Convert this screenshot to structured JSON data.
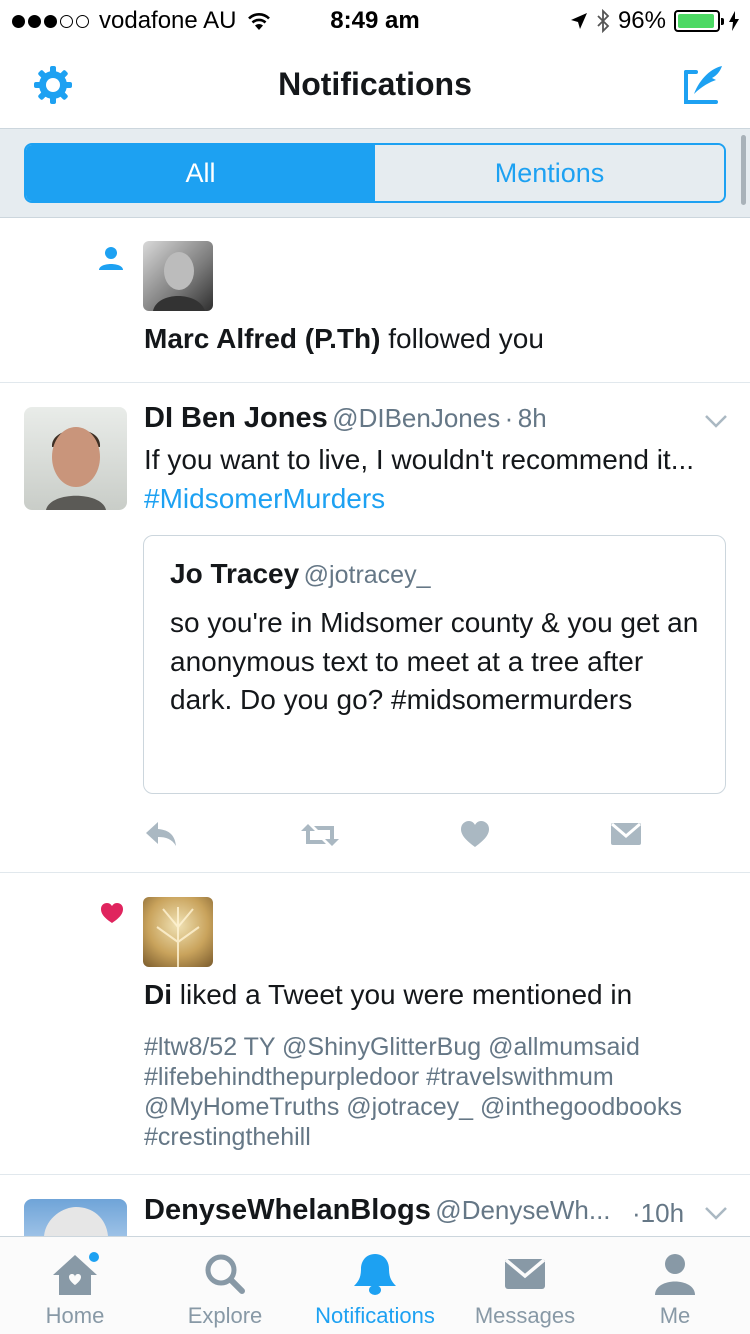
{
  "status_bar": {
    "carrier": "vodafone AU",
    "time": "8:49 am",
    "battery": "96%",
    "battery_level": 0.96
  },
  "nav": {
    "title": "Notifications"
  },
  "segments": {
    "all": "All",
    "mentions": "Mentions"
  },
  "notif_follow": {
    "name": "Marc Alfred (P.Th)",
    "action": "followed you"
  },
  "tweet": {
    "name": "DI Ben Jones",
    "handle": "@DIBenJones",
    "sep": "·",
    "time": "8h",
    "text": "If you want to live, I wouldn't recommend it...",
    "hashtag": "#MidsomerMurders",
    "quote": {
      "name": "Jo Tracey",
      "handle": "@jotracey_",
      "text": "so you're in Midsomer county & you get an anonymous text to meet at a tree after dark. Do you go? #midsomermurders"
    }
  },
  "notif_like": {
    "name": "Di",
    "action": "liked a Tweet you were mentioned in",
    "text_line1": "#ltw8/52 TY @ShinyGlitterBug @allmumsaid",
    "text_line2": "#lifebehindthepurpledoor #travelswithmum",
    "text_line3": "@MyHomeTruths @jotracey_ @inthegoodbooks",
    "text_line4": "#crestingthehill"
  },
  "tweet2": {
    "name": "DenyseWhelanBlogs",
    "handle": "@DenyseWh...",
    "time": "·10h"
  },
  "tabs": {
    "home": "Home",
    "explore": "Explore",
    "notifications": "Notifications",
    "messages": "Messages",
    "me": "Me"
  },
  "colors": {
    "accent": "#1da1f2",
    "like": "#e0245e",
    "muted": "#657786"
  },
  "icons": [
    "gear-icon",
    "compose-icon",
    "follow-person-icon",
    "reply-icon",
    "retweet-icon",
    "like-icon",
    "dm-icon",
    "heart-icon",
    "chevron-down-icon",
    "home-icon",
    "search-icon",
    "bell-icon",
    "envelope-icon",
    "person-icon"
  ]
}
